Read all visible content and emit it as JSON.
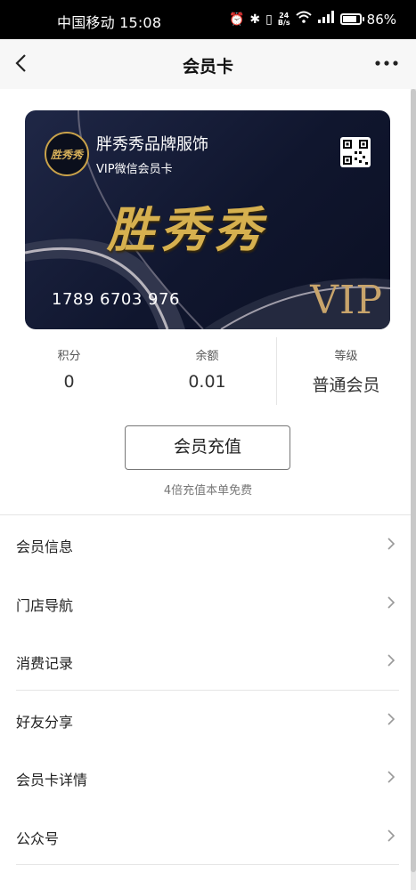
{
  "status_bar": {
    "carrier_time": "中国移动 15:08",
    "speed_value": "24",
    "speed_unit": "B/s",
    "network": "4G",
    "battery": "86%",
    "battery_level": 0.86
  },
  "nav": {
    "title": "会员卡"
  },
  "card": {
    "brand_name": "胖秀秀品牌服饰",
    "subtitle": "VIP微信会员卡",
    "logo_text": "胜秀秀",
    "big_brand": "胜秀秀",
    "card_number": "1789 6703 976",
    "vip_text": "VIP",
    "colors": {
      "background": "#131a33",
      "gold": "#d6b04f"
    }
  },
  "stats": {
    "points_label": "积分",
    "points_value": "0",
    "balance_label": "余额",
    "balance_value": "0.01",
    "level_label": "等级",
    "level_value": "普通会员"
  },
  "recharge": {
    "button_label": "会员充值",
    "note": "4倍充值本单免费"
  },
  "menu": [
    {
      "label": "会员信息"
    },
    {
      "label": "门店导航"
    },
    {
      "label": "消费记录"
    },
    {
      "label": "好友分享"
    },
    {
      "label": "会员卡详情"
    },
    {
      "label": "公众号"
    }
  ]
}
